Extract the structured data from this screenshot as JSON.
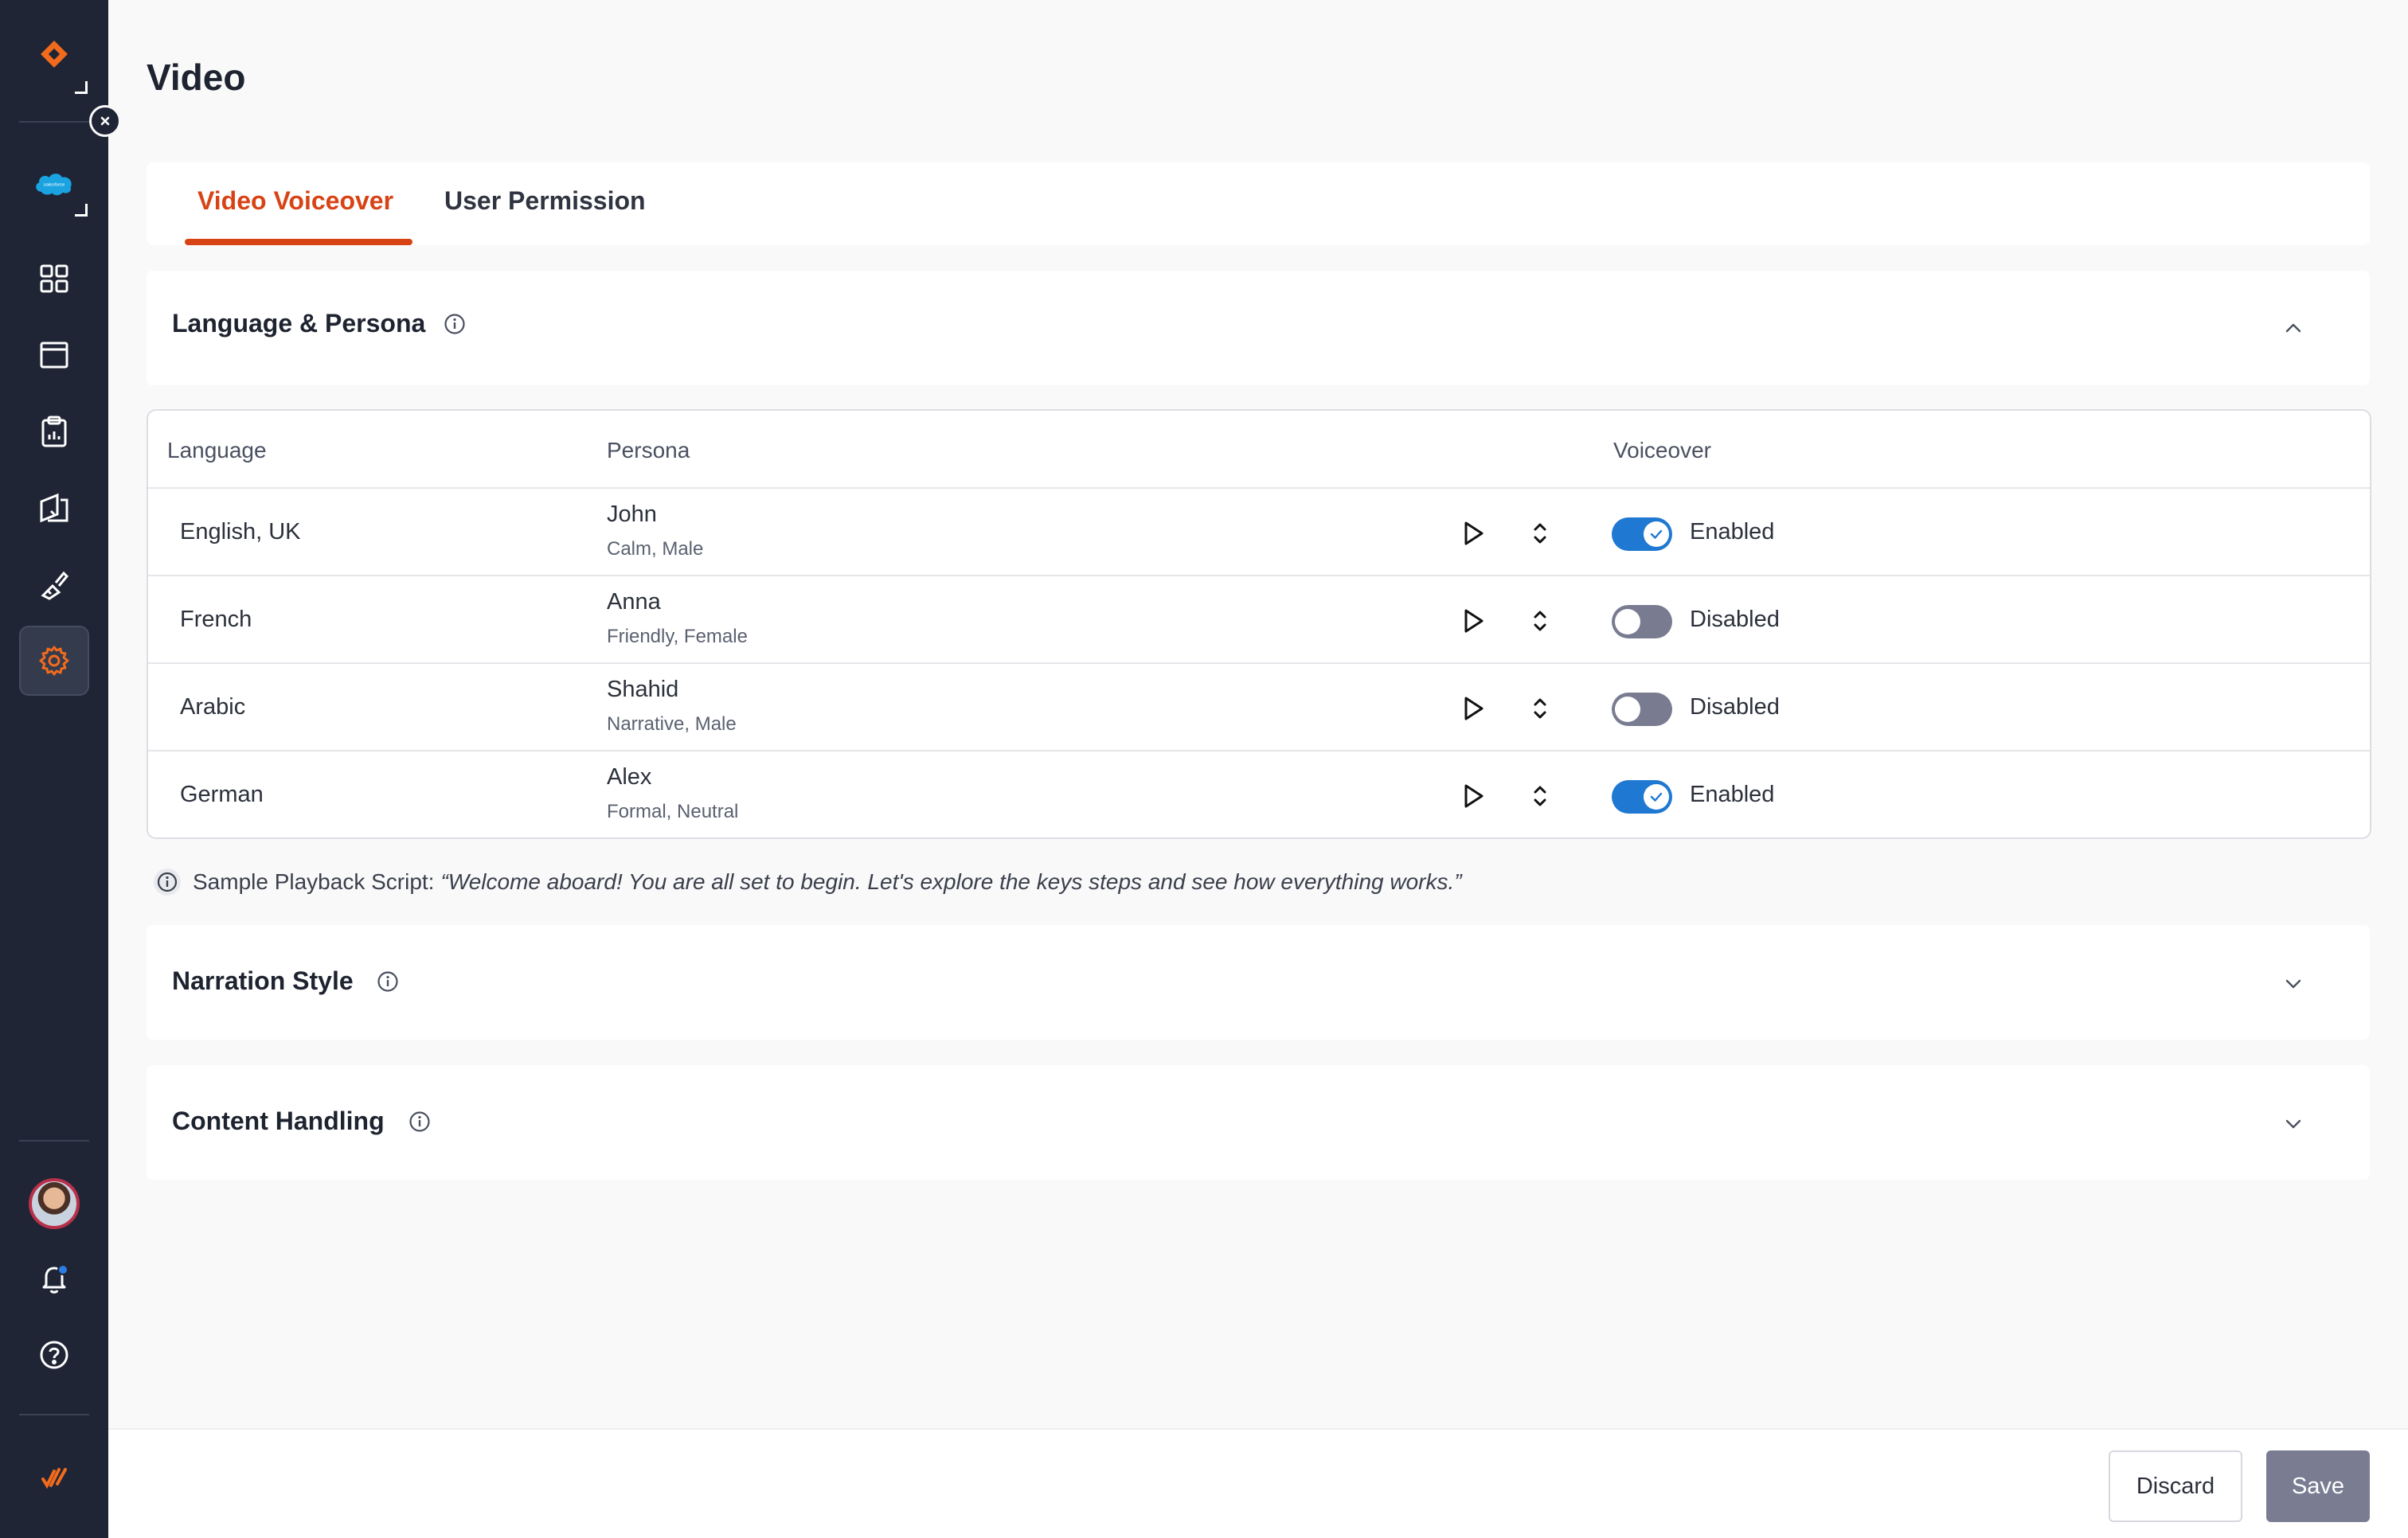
{
  "sidebar": {
    "items": [
      {
        "name": "brand-logo-icon"
      },
      {
        "name": "salesforce-icon",
        "label": "salesforce"
      },
      {
        "name": "dashboard-grid-icon"
      },
      {
        "name": "browser-window-icon"
      },
      {
        "name": "clipboard-report-icon"
      },
      {
        "name": "document-pages-icon"
      },
      {
        "name": "paint-brush-icon"
      },
      {
        "name": "settings-icon",
        "active": true
      }
    ],
    "bottom": [
      {
        "name": "avatar"
      },
      {
        "name": "bell-icon",
        "has_notification": true
      },
      {
        "name": "help-icon"
      },
      {
        "name": "whatfix-logo-icon"
      }
    ],
    "accent_color": "#f26b1d"
  },
  "page": {
    "title": "Video"
  },
  "tabs": [
    {
      "label": "Video Voiceover",
      "active": true
    },
    {
      "label": "User Permission",
      "active": false
    }
  ],
  "sections": {
    "language_persona": {
      "title": "Language & Persona",
      "expanded": true
    },
    "narration_style": {
      "title": "Narration Style",
      "expanded": false
    },
    "content_handling": {
      "title": "Content Handling",
      "expanded": false
    }
  },
  "table": {
    "headers": {
      "language": "Language",
      "persona": "Persona",
      "voiceover": "Voiceover"
    },
    "rows": [
      {
        "language": "English, UK",
        "persona": "John",
        "persona_desc": "Calm, Male",
        "enabled": true,
        "status": "Enabled"
      },
      {
        "language": "French",
        "persona": "Anna",
        "persona_desc": "Friendly, Female",
        "enabled": false,
        "status": "Disabled"
      },
      {
        "language": "Arabic",
        "persona": "Shahid",
        "persona_desc": "Narrative, Male",
        "enabled": false,
        "status": "Disabled"
      },
      {
        "language": "German",
        "persona": "Alex",
        "persona_desc": "Formal, Neutral",
        "enabled": true,
        "status": "Enabled"
      }
    ]
  },
  "note": {
    "label": "Sample Playback Script:",
    "quote": "“Welcome aboard! You are all set to begin. Let's explore the keys steps and see how everything works.”"
  },
  "footer": {
    "discard_label": "Discard",
    "save_label": "Save"
  },
  "colors": {
    "tab_active": "#d84315",
    "toggle_on": "#1f78d1",
    "toggle_off": "#797c91",
    "save_button": "#7a7d92",
    "sidebar_bg": "#1f2535"
  }
}
